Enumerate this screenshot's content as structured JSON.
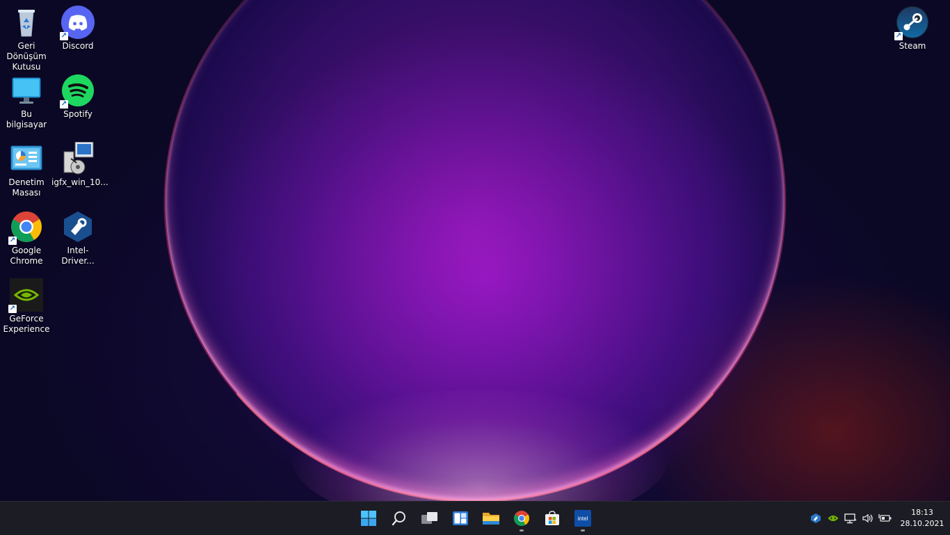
{
  "desktop": {
    "icons": [
      {
        "id": "recycle-bin",
        "label": "Geri Dönüşüm Kutusu",
        "shortcut": false
      },
      {
        "id": "discord",
        "label": "Discord",
        "shortcut": true
      },
      {
        "id": "this-pc",
        "label": "Bu bilgisayar",
        "shortcut": false
      },
      {
        "id": "spotify",
        "label": "Spotify",
        "shortcut": true
      },
      {
        "id": "control-panel",
        "label": "Denetim Masası",
        "shortcut": false
      },
      {
        "id": "igfx",
        "label": "igfx_win_10...",
        "shortcut": false
      },
      {
        "id": "chrome",
        "label": "Google Chrome",
        "shortcut": true
      },
      {
        "id": "intel-driver",
        "label": "Intel-Driver...",
        "shortcut": false
      },
      {
        "id": "geforce",
        "label": "GeForce Experience",
        "shortcut": true
      },
      {
        "id": "steam",
        "label": "Steam",
        "shortcut": true
      }
    ]
  },
  "taskbar": {
    "apps": [
      {
        "id": "start",
        "icon": "windows-start-icon",
        "running": false
      },
      {
        "id": "search",
        "icon": "search-icon",
        "running": false
      },
      {
        "id": "task-view",
        "icon": "task-view-icon",
        "running": false
      },
      {
        "id": "widgets",
        "icon": "widgets-icon",
        "running": false
      },
      {
        "id": "file-explorer",
        "icon": "folder-icon",
        "running": false
      },
      {
        "id": "chrome",
        "icon": "chrome-icon",
        "running": true
      },
      {
        "id": "store",
        "icon": "store-icon",
        "running": false
      },
      {
        "id": "intel",
        "icon": "intel-icon",
        "running": true,
        "text": "intel"
      }
    ],
    "tray": {
      "icons": [
        "intel-driver-tray-icon",
        "nvidia-tray-icon",
        "network-icon",
        "volume-icon",
        "battery-icon"
      ],
      "time": "18:13",
      "date": "28.10.2021"
    }
  },
  "colors": {
    "taskbar_bg": "#1c1c24",
    "windows_blue": "#4cc2ff",
    "discord": "#5865f2",
    "spotify": "#1ed760",
    "nvidia": "#76b900"
  }
}
